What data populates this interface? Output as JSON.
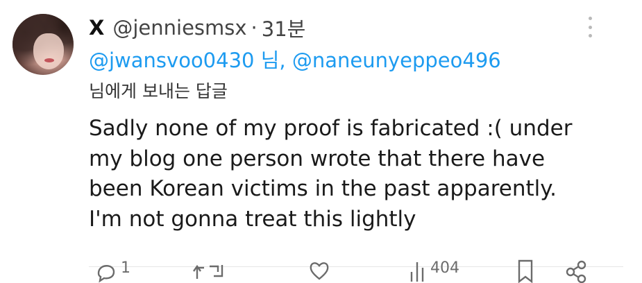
{
  "tweet": {
    "author": {
      "name": "X",
      "handle": "@jenniesmsx",
      "dot": "·",
      "time": "31분",
      "avatar_icon": "profile-avatar"
    },
    "replying_to": {
      "user1": "@jwansvoo0430",
      "joiner": " 님, ",
      "user2": "@naneunyeppeo496",
      "suffix": "님에게 보내는 답글"
    },
    "text_lines": [
      "Sadly none of my proof is fabricated :( under",
      "my blog one person wrote that there have",
      "been Korean victims in the past apparently.",
      "I'm not gonna treat this lightly"
    ],
    "actions": {
      "reply_count": "1",
      "repost_count": "",
      "like_count": "",
      "views_count": "404"
    }
  },
  "colors": {
    "link": "#1d9bf0",
    "text": "#1a1a1a",
    "muted": "#6b6b6b"
  }
}
